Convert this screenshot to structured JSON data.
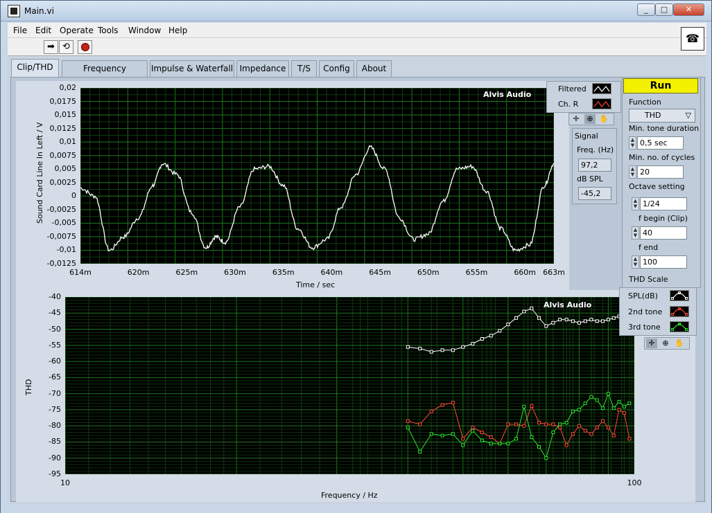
{
  "window": {
    "title": "Main.vi"
  },
  "menu": [
    "File",
    "Edit",
    "Operate",
    "Tools",
    "Window",
    "Help"
  ],
  "toolbar": {
    "run_icon": "arrow-run-icon",
    "continuous_icon": "continuous-run-icon",
    "abort_icon": "abort-icon"
  },
  "tabs": [
    "Clip/THD",
    "Frequency Response",
    "Impulse & Waterfall",
    "Impedance",
    "T/S",
    "Config",
    "About"
  ],
  "time_graph": {
    "watermark": "Alvis Audio",
    "ylabel": "Sound Card Line In Left / V",
    "xlabel": "Time / sec",
    "yticks": [
      "0,02",
      "0,0175",
      "0,015",
      "0,0125",
      "0,01",
      "0,0075",
      "0,005",
      "0,0025",
      "0",
      "-0,0025",
      "-0,005",
      "-0,0075",
      "-0,01",
      "-0,0125"
    ],
    "xticks": [
      "614m",
      "620m",
      "625m",
      "630m",
      "635m",
      "640m",
      "645m",
      "650m",
      "655m",
      "660m",
      "663m"
    ],
    "legend": [
      {
        "label": "Filtered",
        "color": "#ffffff"
      },
      {
        "label": "Ch. R",
        "color": "#ff4030"
      }
    ]
  },
  "signal": {
    "title": "Signal",
    "freq_label": "Freq. (Hz)",
    "freq_value": "97,2",
    "spl_label": "dB SPL",
    "spl_value": "-45,2"
  },
  "controls": {
    "run_label": "Run",
    "function_label": "Function",
    "function_value": "THD",
    "min_tone_label": "Min. tone duration",
    "min_tone_value": "0,5 sec",
    "min_cycles_label": "Min. no. of cycles",
    "min_cycles_value": "20",
    "octave_label": "Octave setting",
    "octave_value": "1/24",
    "fbegin_label": "f begin (Clip)",
    "fbegin_value": "40",
    "fend_label": "f end",
    "fend_value": "100",
    "thd_scale_label": "THD Scale"
  },
  "thd_graph": {
    "watermark": "Alvis Audio",
    "ylabel": "THD",
    "xlabel": "Frequency / Hz",
    "yticks": [
      "-40",
      "-45",
      "-50",
      "-55",
      "-60",
      "-65",
      "-70",
      "-75",
      "-80",
      "-85",
      "-90",
      "-95"
    ],
    "xticks": [
      "10",
      "100"
    ],
    "legend": [
      {
        "label": "SPL(dB)",
        "color": "#ffffff"
      },
      {
        "label": "2nd tone",
        "color": "#ff4b3a"
      },
      {
        "label": "3rd tone",
        "color": "#2ee82e"
      }
    ]
  },
  "chart_data": [
    {
      "type": "line",
      "xlabel": "Time / sec",
      "ylabel": "Sound Card Line In Left / V",
      "xlim": [
        0.614,
        0.663
      ],
      "ylim": [
        -0.0125,
        0.02
      ],
      "series": [
        {
          "name": "Filtered",
          "x": [
            0.614,
            0.6155,
            0.617,
            0.6185,
            0.62,
            0.6215,
            0.6225,
            0.624,
            0.6255,
            0.627,
            0.628,
            0.629,
            0.6305,
            0.632,
            0.6335,
            0.635,
            0.6365,
            0.638,
            0.6395,
            0.641,
            0.6425,
            0.644,
            0.6455,
            0.647,
            0.6485,
            0.65,
            0.6515,
            0.653,
            0.6545,
            0.656,
            0.6575,
            0.659,
            0.6605,
            0.662,
            0.663
          ],
          "y": [
            0.0015,
            0,
            -0.01,
            -0.0075,
            -0.004,
            0.002,
            0.006,
            0.004,
            -0.003,
            -0.0095,
            -0.0075,
            -0.0085,
            -0.002,
            0.005,
            0.0055,
            0.002,
            -0.006,
            -0.0095,
            -0.008,
            -0.002,
            0.004,
            0.009,
            0.005,
            -0.004,
            -0.008,
            -0.007,
            -0.001,
            0.005,
            0.0055,
            0.001,
            -0.006,
            -0.01,
            -0.009,
            0.002,
            0.006
          ]
        }
      ]
    },
    {
      "type": "line",
      "xlabel": "Frequency / Hz",
      "ylabel": "THD",
      "xscale": "log",
      "xlim": [
        10,
        100
      ],
      "ylim": [
        -95,
        -40
      ],
      "series": [
        {
          "name": "SPL(dB)",
          "x": [
            40,
            42,
            44,
            46,
            48,
            50,
            52,
            54,
            56,
            58,
            60,
            62,
            64,
            66,
            68,
            70,
            72,
            74,
            76,
            78,
            80,
            82,
            84,
            86,
            88,
            90,
            92,
            94,
            96,
            98
          ],
          "y": [
            -55.5,
            -56,
            -57,
            -56.5,
            -56.5,
            -55.5,
            -54.5,
            -53,
            -52,
            -50.5,
            -48.5,
            -46.5,
            -44.5,
            -43.5,
            -46.5,
            -49,
            -48,
            -47,
            -47,
            -47.5,
            -48,
            -47.5,
            -47,
            -47.5,
            -47.5,
            -47,
            -46.5,
            -46,
            -46.5,
            -46
          ]
        },
        {
          "name": "2nd tone",
          "x": [
            40,
            42,
            44,
            46,
            48,
            50,
            52,
            54,
            56,
            58,
            60,
            62,
            64,
            66,
            68,
            70,
            72,
            74,
            76,
            78,
            80,
            82,
            84,
            86,
            88,
            90,
            92,
            94,
            96,
            98
          ],
          "y": [
            -78.5,
            -79.5,
            -75.5,
            -73.5,
            -72.8,
            -84,
            -80.5,
            -82,
            -83.5,
            -85.5,
            -79.5,
            -79.5,
            -80,
            -73.8,
            -79,
            -79.5,
            -79.5,
            -80.5,
            -86,
            -82.5,
            -80,
            -81.5,
            -82.5,
            -80.5,
            -78.5,
            -80.5,
            -83,
            -75,
            -76,
            -84
          ]
        },
        {
          "name": "3rd tone",
          "x": [
            40,
            42,
            44,
            46,
            48,
            50,
            52,
            54,
            56,
            58,
            60,
            62,
            64,
            66,
            68,
            70,
            72,
            74,
            76,
            78,
            80,
            82,
            84,
            86,
            88,
            90,
            92,
            94,
            96,
            98
          ],
          "y": [
            -80.5,
            -88,
            -82.5,
            -83,
            -82.5,
            -86,
            -81.5,
            -84.5,
            -85.5,
            -85.5,
            -85.5,
            -84,
            -74,
            -83.5,
            -86.5,
            -90,
            -82,
            -79.5,
            -79,
            -75.5,
            -75,
            -73,
            -71,
            -72,
            -74.5,
            -70,
            -74.5,
            -72.5,
            -74,
            -73
          ]
        }
      ]
    }
  ]
}
